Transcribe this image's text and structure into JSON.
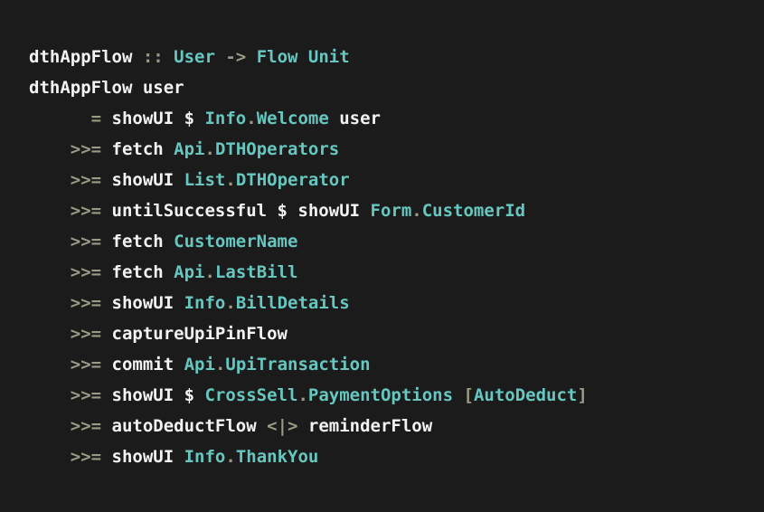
{
  "colors": {
    "background": "#1b1b1b",
    "plain": "#f3f3f3",
    "operator": "#9a9a86",
    "type": "#66c7c0"
  },
  "code": {
    "lines": [
      [
        {
          "t": "dthAppFlow",
          "c": "plain"
        },
        {
          "t": " :: ",
          "c": "op"
        },
        {
          "t": "User",
          "c": "type"
        },
        {
          "t": " -> ",
          "c": "op"
        },
        {
          "t": "Flow Unit",
          "c": "type"
        }
      ],
      [
        {
          "t": "dthAppFlow user",
          "c": "plain"
        }
      ],
      [
        {
          "t": "      ",
          "c": "plain"
        },
        {
          "t": "=",
          "c": "op"
        },
        {
          "t": " showUI $ ",
          "c": "plain"
        },
        {
          "t": "Info",
          "c": "type"
        },
        {
          "t": ".",
          "c": "op"
        },
        {
          "t": "Welcome",
          "c": "type"
        },
        {
          "t": " user",
          "c": "plain"
        }
      ],
      [
        {
          "t": "    ",
          "c": "plain"
        },
        {
          "t": ">>=",
          "c": "op"
        },
        {
          "t": " fetch ",
          "c": "plain"
        },
        {
          "t": "Api",
          "c": "type"
        },
        {
          "t": ".",
          "c": "op"
        },
        {
          "t": "DTHOperators",
          "c": "type"
        }
      ],
      [
        {
          "t": "    ",
          "c": "plain"
        },
        {
          "t": ">>=",
          "c": "op"
        },
        {
          "t": " showUI ",
          "c": "plain"
        },
        {
          "t": "List",
          "c": "type"
        },
        {
          "t": ".",
          "c": "op"
        },
        {
          "t": "DTHOperator",
          "c": "type"
        }
      ],
      [
        {
          "t": "    ",
          "c": "plain"
        },
        {
          "t": ">>=",
          "c": "op"
        },
        {
          "t": " untilSuccessful $ showUI ",
          "c": "plain"
        },
        {
          "t": "Form",
          "c": "type"
        },
        {
          "t": ".",
          "c": "op"
        },
        {
          "t": "CustomerId",
          "c": "type"
        }
      ],
      [
        {
          "t": "    ",
          "c": "plain"
        },
        {
          "t": ">>=",
          "c": "op"
        },
        {
          "t": " fetch ",
          "c": "plain"
        },
        {
          "t": "CustomerName",
          "c": "type"
        }
      ],
      [
        {
          "t": "    ",
          "c": "plain"
        },
        {
          "t": ">>=",
          "c": "op"
        },
        {
          "t": " fetch ",
          "c": "plain"
        },
        {
          "t": "Api",
          "c": "type"
        },
        {
          "t": ".",
          "c": "op"
        },
        {
          "t": "LastBill",
          "c": "type"
        }
      ],
      [
        {
          "t": "    ",
          "c": "plain"
        },
        {
          "t": ">>=",
          "c": "op"
        },
        {
          "t": " showUI ",
          "c": "plain"
        },
        {
          "t": "Info",
          "c": "type"
        },
        {
          "t": ".",
          "c": "op"
        },
        {
          "t": "BillDetails",
          "c": "type"
        }
      ],
      [
        {
          "t": "    ",
          "c": "plain"
        },
        {
          "t": ">>=",
          "c": "op"
        },
        {
          "t": " captureUpiPinFlow",
          "c": "plain"
        }
      ],
      [
        {
          "t": "    ",
          "c": "plain"
        },
        {
          "t": ">>=",
          "c": "op"
        },
        {
          "t": " commit ",
          "c": "plain"
        },
        {
          "t": "Api",
          "c": "type"
        },
        {
          "t": ".",
          "c": "op"
        },
        {
          "t": "UpiTransaction",
          "c": "type"
        }
      ],
      [
        {
          "t": "    ",
          "c": "plain"
        },
        {
          "t": ">>=",
          "c": "op"
        },
        {
          "t": " showUI $ ",
          "c": "plain"
        },
        {
          "t": "CrossSell",
          "c": "type"
        },
        {
          "t": ".",
          "c": "op"
        },
        {
          "t": "PaymentOptions",
          "c": "type"
        },
        {
          "t": " [",
          "c": "op"
        },
        {
          "t": "AutoDeduct",
          "c": "type"
        },
        {
          "t": "]",
          "c": "op"
        }
      ],
      [
        {
          "t": "    ",
          "c": "plain"
        },
        {
          "t": ">>=",
          "c": "op"
        },
        {
          "t": " autoDeductFlow ",
          "c": "plain"
        },
        {
          "t": "<|>",
          "c": "op"
        },
        {
          "t": " reminderFlow",
          "c": "plain"
        }
      ],
      [
        {
          "t": "    ",
          "c": "plain"
        },
        {
          "t": ">>=",
          "c": "op"
        },
        {
          "t": " showUI ",
          "c": "plain"
        },
        {
          "t": "Info",
          "c": "type"
        },
        {
          "t": ".",
          "c": "op"
        },
        {
          "t": "ThankYou",
          "c": "type"
        }
      ]
    ]
  }
}
